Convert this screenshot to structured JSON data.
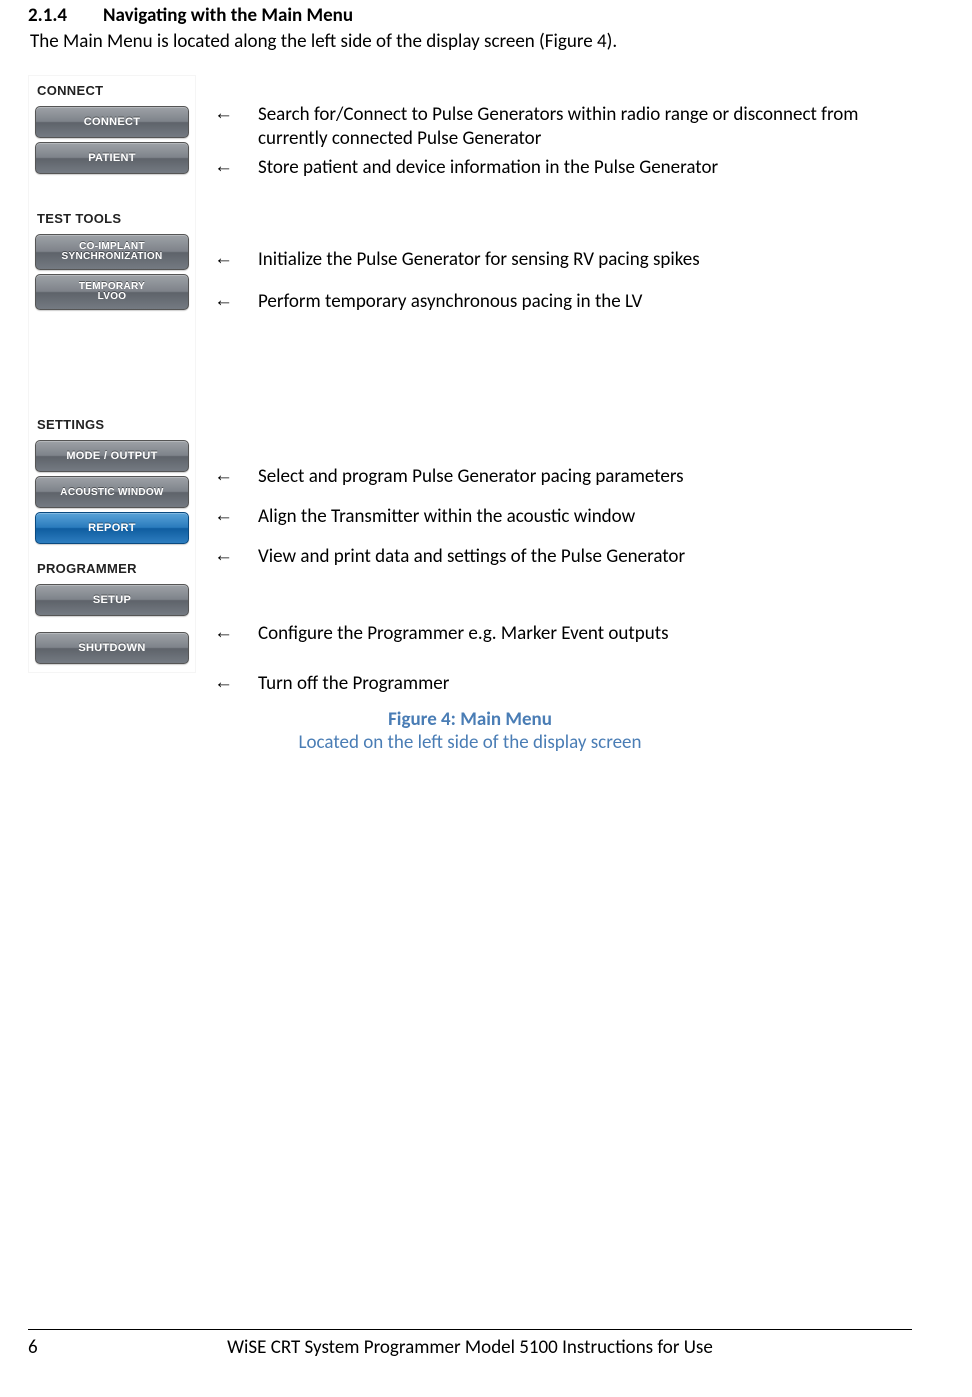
{
  "heading": {
    "number": "2.1.4",
    "title": "Navigating with the Main Menu"
  },
  "intro": "The Main Menu is located along the left side of the display screen (Figure 4).",
  "arrow_glyph": "←",
  "menu": {
    "connect": {
      "label": "CONNECT",
      "buttons": {
        "connect": "CONNECT",
        "patient": "PATIENT"
      }
    },
    "testtools": {
      "label": "TEST TOOLS",
      "buttons": {
        "coimplant_l1": "CO-IMPLANT",
        "coimplant_l2": "SYNCHRONIZATION",
        "temp_l1": "TEMPORARY",
        "temp_l2": "LVOO"
      }
    },
    "settings": {
      "label": "SETTINGS",
      "buttons": {
        "mode": "MODE / OUTPUT",
        "acoustic": "ACOUSTIC WINDOW",
        "report": "REPORT"
      }
    },
    "programmer": {
      "label": "PROGRAMMER",
      "buttons": {
        "setup": "SETUP",
        "shutdown": "SHUTDOWN"
      }
    }
  },
  "desc": {
    "connect": "Search for/Connect to Pulse Generators within radio range or disconnect from currently connected Pulse Generator",
    "patient": "Store patient and device information in the Pulse Generator",
    "coimplant": "Initialize the Pulse Generator for sensing RV pacing spikes",
    "temp": "Perform temporary asynchronous pacing in the LV",
    "mode": "Select and program Pulse Generator pacing parameters",
    "acoustic": "Align the Transmitter within the acoustic window",
    "report": "View and print data and settings of the Pulse Generator",
    "setup": "Configure the Programmer e.g. Marker Event outputs",
    "shutdown": "Turn off the Programmer"
  },
  "figure": {
    "title": "Figure 4: Main Menu",
    "sub": "Located on the left side of the display screen"
  },
  "footer": {
    "page": "6",
    "text": "WiSE CRT System Programmer Model 5100 Instructions for Use"
  }
}
